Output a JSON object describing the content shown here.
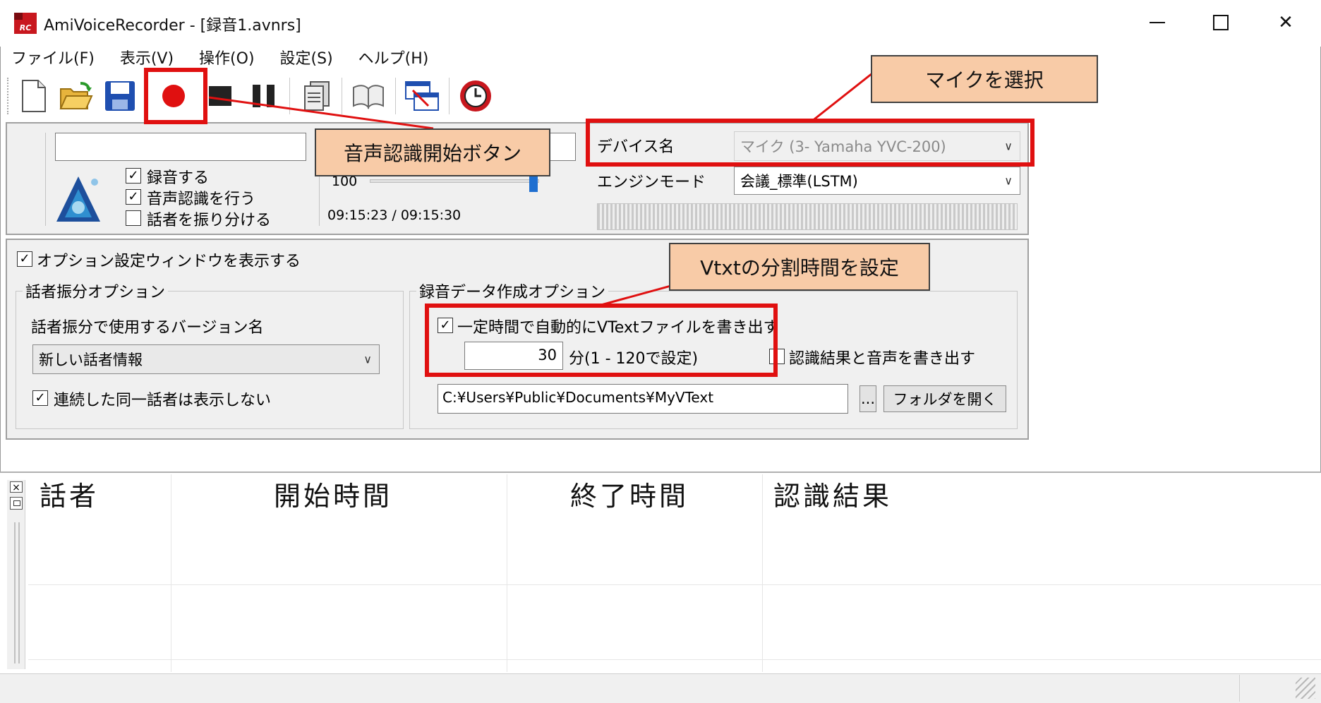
{
  "window": {
    "title": "AmiVoiceRecorder - [録音1.avnrs]",
    "icon_text": "RC"
  },
  "window_controls": {
    "minimize": "—",
    "maximize": "☐",
    "close": "✕"
  },
  "menu": [
    "ファイル(F)",
    "表示(V)",
    "操作(O)",
    "設定(S)",
    "ヘルプ(H)"
  ],
  "recorder": {
    "record_checkbox": "録音する",
    "recognize_checkbox": "音声認識を行う",
    "speaker_checkbox": "話者を振り分ける",
    "volume_value": "100",
    "time_display": "09:15:23 / 09:15:30",
    "device_label": "デバイス名",
    "device_value": "マイク (3- Yamaha YVC-200)",
    "engine_label": "エンジンモード",
    "engine_value": "会議_標準(LSTM)"
  },
  "options": {
    "show_option_window": "オプション設定ウィンドウを表示する",
    "speaker_group": {
      "title": "話者振分オプション",
      "version_label": "話者振分で使用するバージョン名",
      "version_value": "新しい話者情報",
      "hide_same_speaker": "連続した同一話者は表示しない"
    },
    "record_group": {
      "title": "録音データ作成オプション",
      "auto_write": "一定時間で自動的にVTextファイルを書き出す",
      "interval_value": "30",
      "interval_unit": "分(1 - 120で設定)",
      "write_audio": "認識結果と音声を書き出す",
      "folder_path": "C:¥Users¥Public¥Documents¥MyVText",
      "browse_label": "...",
      "open_folder_label": "フォルダを開く"
    }
  },
  "annotations": {
    "mic_select": "マイクを選択",
    "start_button": "音声認識開始ボタン",
    "vtxt_split": "Vtxtの分割時間を設定"
  },
  "table": {
    "columns": [
      "話者",
      "開始時間",
      "終了時間",
      "認識結果"
    ]
  },
  "colors": {
    "accent_red": "#e01010",
    "callout_fill": "#f8cba7",
    "record_red": "#e01010"
  }
}
